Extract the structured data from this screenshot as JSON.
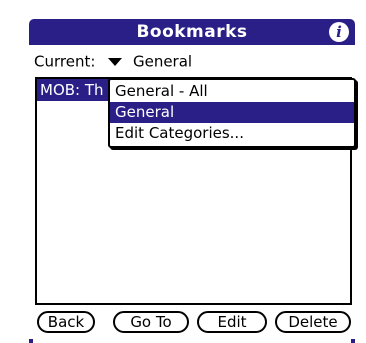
{
  "title_bar": {
    "title": "Bookmarks",
    "info_icon": "i"
  },
  "category": {
    "label": "Current:",
    "selected": "General"
  },
  "bookmark_list": {
    "items": [
      {
        "label": "MOB: Th"
      }
    ]
  },
  "category_popup": {
    "items": [
      {
        "label": "General - All",
        "selected": false
      },
      {
        "label": "General",
        "selected": true
      },
      {
        "label": "Edit Categories...",
        "selected": false
      }
    ]
  },
  "buttons": {
    "back": "Back",
    "go_to": "Go To",
    "edit": "Edit",
    "delete": "Delete"
  },
  "colors": {
    "accent": "#2a1f86",
    "background": "#ffffff",
    "text": "#000000"
  }
}
